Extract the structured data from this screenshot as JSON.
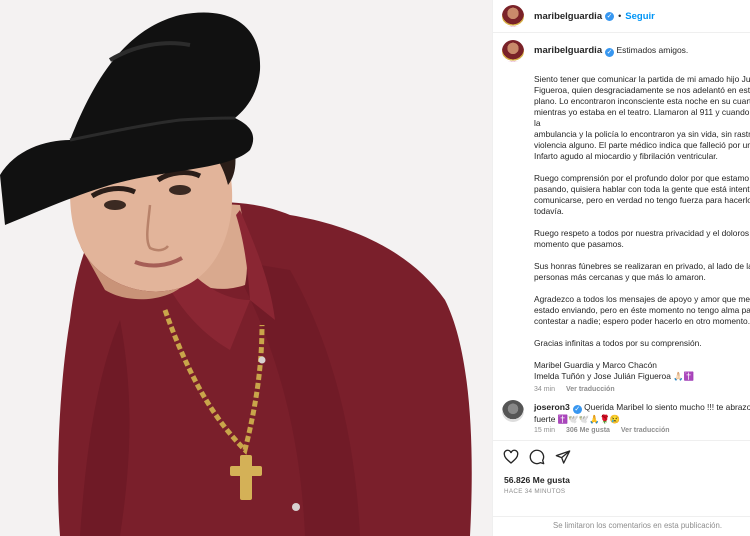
{
  "header": {
    "username": "maribelguardia",
    "separator": "•",
    "follow_label": "Seguir"
  },
  "caption": {
    "username": "maribelguardia",
    "first_line": "Estimados amigos.",
    "paragraphs": [
      "Siento tener que comunicar la partida de mi amado hijo Ju\nFigueroa, quien desgraciadamente se nos adelantó en este\nplano. Lo encontraron inconsciente esta noche en su cuart\nmientras yo estaba en el teatro. Llamaron al 911 y cuando\nla\nambulancia y la policía lo encontraron ya sin vida, sin rastro\nviolencia alguno. El parte médico indica que falleció por un\nInfarto agudo al miocardio y fibrilación ventricular.",
      "Ruego comprensión por el profundo dolor por que estamo\npasando, quisiera hablar con toda la gente que está intent\ncomunicarse, pero en verdad no tengo fuerza para hacerlo\ntodavía.",
      "Ruego respeto a todos por nuestra privacidad y el doloros\nmomento que pasamos.",
      "Sus honras fúnebres se realizaran en privado, al lado de las\npersonas más cercanas y que más lo amaron.",
      "Agradezco a todos los mensajes de apoyo y amor que me\nestado enviando, pero en éste momento no tengo alma pa\ncontestar a nadie; espero poder hacerlo en otro momento.",
      "Gracias infinitas a todos por su comprensión.",
      "Maribel Guardia y Marco Chacón\nImelda Tuñón y Jose Julián Figueroa 🙏🏻✝️"
    ],
    "time": "34 min",
    "translate": "Ver traducción"
  },
  "reply": {
    "username": "joseron3",
    "text": "Querida Maribel lo siento mucho !!! te abrazo\nfuerte ✝️🕊️🕊️🙏🌹😢",
    "time": "15 min",
    "likes": "306 Me gusta",
    "translate": "Ver traducción"
  },
  "footer": {
    "likes": "56.826 Me gusta",
    "time_ago": "HACE 34 MINUTOS",
    "comments_limited": "Se limitaron los comentarios en esta publicación."
  },
  "icons": [
    "heart-icon",
    "comment-icon",
    "share-icon",
    "verified-badge-icon"
  ],
  "colors": {
    "link": "#0095f6",
    "muted": "#8e8e8e",
    "verified": "#3897f0",
    "shirt": "#7a1f2b",
    "hat": "#111111"
  }
}
